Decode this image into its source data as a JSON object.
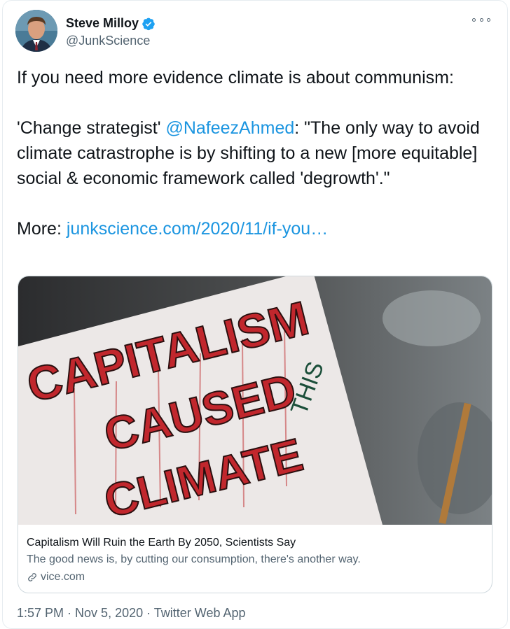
{
  "author": {
    "name": "Steve Milloy",
    "handle": "@JunkScience"
  },
  "tweet": {
    "line1": "If you need more evidence climate is about communism:",
    "para2_prefix": "'Change strategist' ",
    "mention": "@NafeezAhmed",
    "para2_suffix": ": \"The only way to avoid climate catrastrophe is by shifting to a new [more equitable] social & economic framework called 'degrowth'.\"",
    "more_label": "More: ",
    "more_link": "junkscience.com/2020/11/if-you…"
  },
  "card": {
    "image_alt": "Protest sign reading CAPITALISM CAUSED THIS CLIMATE CATASTROPHE",
    "sign_words": [
      "CAPITALISM",
      "CAUSED",
      "CLIMATE",
      "THIS"
    ],
    "title": "Capitalism Will Ruin the Earth By 2050, Scientists Say",
    "description": "The good news is, by cutting our consumption, there's another way.",
    "domain": "vice.com"
  },
  "footer": {
    "time": "1:57 PM",
    "sep": " · ",
    "date": "Nov 5, 2020",
    "source": "Twitter Web App"
  },
  "colors": {
    "link": "#1b95e0",
    "verified": "#1da1f2",
    "muted": "#536471",
    "border": "#cfd9de"
  }
}
